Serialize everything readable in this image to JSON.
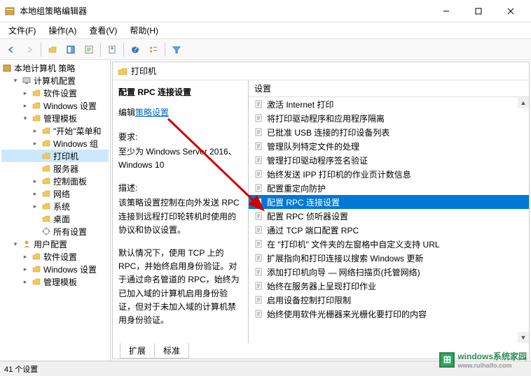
{
  "window": {
    "title": "本地组策略编辑器"
  },
  "menu": {
    "file": "文件(F)",
    "action": "操作(A)",
    "view": "查看(V)",
    "help": "帮助(H)"
  },
  "tree": {
    "root": "本地计算机 策略",
    "computer_config": "计算机配置",
    "software_settings": "软件设置",
    "windows_settings": "Windows 设置",
    "admin_templates": "管理模板",
    "start_menu": "\"开始\"菜单和",
    "windows_group": "Windows 组",
    "printers": "打印机",
    "servers": "服务器",
    "control_panel": "控制面板",
    "network": "网络",
    "system": "系统",
    "desktop": "桌面",
    "all_settings": "所有设置",
    "user_config": "用户配置",
    "user_software": "软件设置",
    "user_windows": "Windows 设置",
    "user_admin": "管理模板"
  },
  "panel": {
    "header": "打印机",
    "item_title": "配置 RPC 连接设置",
    "edit_prefix": "编辑",
    "edit_link": "策略设置",
    "req_label": "要求:",
    "req_text": "至少为 Windows Server 2016、Windows 10",
    "desc_label": "描述:",
    "desc_text1": "该策略设置控制在向外发送 RPC 连接到远程打印轮转机时使用的协议和协议设置。",
    "desc_text2": "默认情况下，使用 TCP 上的 RPC，并始终启用身份验证。对于通过命名管道的 RPC，始终为已加入域的计算机启用身份验证，但对于未加入域的计算机禁用身份验证。"
  },
  "list": {
    "header": "设置",
    "items": [
      "激活 Internet 打印",
      "将打印驱动程序和应用程序隔离",
      "已批准 USB 连接的打印设备列表",
      "管理队列特定文件的处理",
      "管理打印驱动程序签名验证",
      "始终发送 IPP 打印机的作业页计数信息",
      "配置重定向防护",
      "配置 RPC 连接设置",
      "配置 RPC 侦听器设置",
      "通过 TCP 端口配置 RPC",
      "在 \"打印机\" 文件夹的左窗格中自定义支持 URL",
      "扩展指向和打印连接以搜索 Windows 更新",
      "添加打印机向导 — 网络扫描页(托管网络)",
      "始终在服务器上呈现打印作业",
      "启用设备控制打印限制",
      "始终使用软件光栅器来光栅化要打印的内容"
    ],
    "selected_index": 7
  },
  "tabs": {
    "extended": "扩展",
    "standard": "标准"
  },
  "statusbar": "41 个设置",
  "watermark": {
    "text": "windows系统家园",
    "sub": "www.ruihaifo.com"
  }
}
